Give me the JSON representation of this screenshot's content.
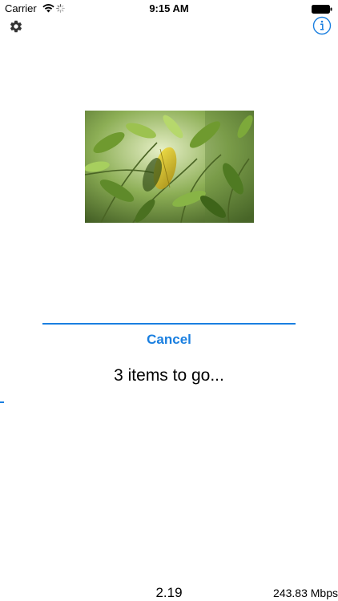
{
  "status_bar": {
    "carrier": "Carrier",
    "time": "9:15 AM",
    "icons": [
      "wifi-icon",
      "activity-spinner-icon",
      "battery-icon"
    ]
  },
  "toolbar": {
    "settings_icon": "gear-icon",
    "info_icon": "info-circle-icon"
  },
  "colors": {
    "accent": "#1a7fe0",
    "track": "#d8d8d8",
    "background": "#ffffff"
  },
  "main": {
    "image": "leafy-plant-photo",
    "progress": 1.0,
    "cancel_label": "Cancel",
    "remaining_text": "3 items to go..."
  },
  "footer": {
    "value": "2.19",
    "speed": "243.83 Mbps"
  }
}
